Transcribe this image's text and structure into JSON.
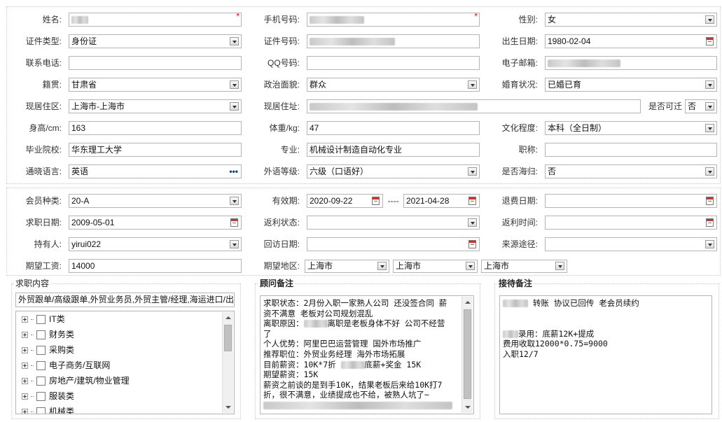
{
  "basic": {
    "name_label": "姓名:",
    "mobile_label": "手机号码:",
    "gender_label": "性别:",
    "gender_value": "女",
    "id_type_label": "证件类型:",
    "id_type_value": "身份证",
    "id_number_label": "证件号码:",
    "birth_date_label": "出生日期:",
    "birth_date_value": "1980-02-04",
    "contact_phone_label": "联系电话:",
    "qq_label": "QQ号码:",
    "email_label": "电子邮箱:",
    "native_place_label": "籍贯:",
    "native_place_value": "甘肃省",
    "political_label": "政治面貌:",
    "political_value": "群众",
    "marital_label": "婚育状况:",
    "marital_value": "已婚已育",
    "residence_area_label": "现居住区:",
    "residence_area_value": "上海市-上海市",
    "address_label": "现居住址:",
    "relocate_label": "是否可迁",
    "relocate_value": "否",
    "height_label": "身高/cm:",
    "height_value": "163",
    "weight_label": "体重/kg:",
    "weight_value": "47",
    "education_label": "文化程度:",
    "education_value": "本科（全日制）",
    "school_label": "毕业院校:",
    "school_value": "华东理工大学",
    "major_label": "专业:",
    "major_value": "机械设计制造自动化专业",
    "title_label": "职称:",
    "language_label": "通晓语言:",
    "language_value": "英语",
    "language_more": "•••",
    "language_level_label": "外语等级:",
    "language_level_value": "六级（口语好）",
    "overseas_label": "是否海归:",
    "overseas_value": "否",
    "required_mark": "*"
  },
  "membership": {
    "member_type_label": "会员种类:",
    "member_type_value": "20-A",
    "validity_label": "有效期:",
    "validity_start": "2020-09-22",
    "validity_sep": "----",
    "validity_end": "2021-04-28",
    "refund_date_label": "退费日期:",
    "job_seek_date_label": "求职日期:",
    "job_seek_date_value": "2009-05-01",
    "rebate_status_label": "返利状态:",
    "rebate_time_label": "返利时间:",
    "holder_label": "持有人:",
    "holder_value": "yirui022",
    "visit_date_label": "回访日期:",
    "source_label": "来源途径:",
    "expected_salary_label": "期望工资:",
    "expected_salary_value": "14000",
    "expected_region_label": "期望地区:",
    "expected_region_values": [
      "上海市",
      "上海市",
      "上海市"
    ]
  },
  "job_content": {
    "title": "求职内容",
    "summary": "外贸跟单/高级跟单,外贸业务员,外贸主管/经理,海运进口/出",
    "categories": [
      "IT类",
      "财务类",
      "采购类",
      "电子商务/互联网",
      "房地产/建筑/物业管理",
      "服装类",
      "机械类"
    ]
  },
  "advisor_notes": {
    "title": "顾问备注",
    "lines": [
      "求职状态：2月份入职一家熟人公司 还没签合同 薪",
      "资不满意 老板对公司规划混乱",
      "离职原因：|离职是老板身体不好 公司不经营",
      "了",
      "个人优势：阿里巴巴运营管理 国外市场推广",
      "推荐职位：外贸业务经理  海外市场拓展",
      "目前薪资：10K*7折  |底薪+奖金 15K",
      "期望薪资：15K",
      "薪资之前谈的是到手10K，结果老板后来给10K打7",
      "折，很不满意，业绩提成也不给，被熟人坑了~",
      ""
    ]
  },
  "handover_notes": {
    "title": "接待备注",
    "lines": [
      " 转账 协议已回传 老会员续约",
      "",
      "",
      "录用：底薪12K+提成",
      "费用收取12000*0.75=9000",
      "入职12/7"
    ]
  }
}
